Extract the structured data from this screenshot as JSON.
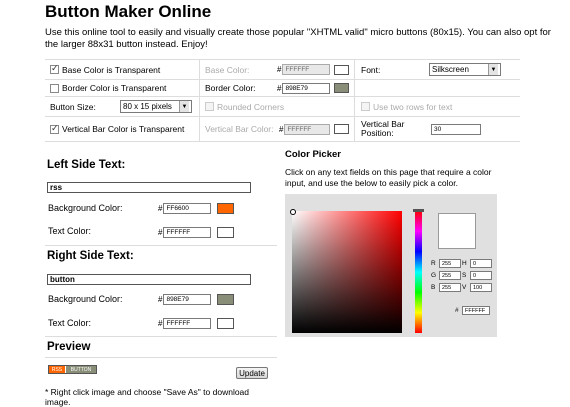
{
  "title": "Button Maker Online",
  "intro": "Use this online tool to easily and visually create those popular \"XHTML valid\" micro buttons (80x15). You can also opt for the larger 88x31 button instead. Enjoy!",
  "options": {
    "base_transparent": "Base Color is Transparent",
    "base_color_label": "Base Color:",
    "base_color_value": "FFFFFF",
    "font_label": "Font:",
    "font_value": "Silkscreen",
    "border_transparent": "Border Color is Transparent",
    "border_color_label": "Border Color:",
    "border_color_value": "898E79",
    "button_size_label": "Button Size:",
    "button_size_value": "80 x 15 pixels",
    "rounded_corners": "Rounded Corners",
    "two_rows": "Use two rows for text",
    "vertical_bar_transparent": "Vertical Bar Color is Transparent",
    "vertical_bar_color_label": "Vertical Bar Color:",
    "vertical_bar_color_value": "FFFFFF",
    "vertical_bar_position_label": "Vertical Bar Position:",
    "vertical_bar_position_value": "30"
  },
  "left": {
    "heading": "Left Side Text:",
    "text": "rss",
    "bg_label": "Background Color:",
    "bg_value": "FF6600",
    "text_color_label": "Text Color:",
    "text_color_value": "FFFFFF"
  },
  "right": {
    "heading": "Right Side Text:",
    "text": "button",
    "bg_label": "Background Color:",
    "bg_value": "898E79",
    "text_color_label": "Text Color:",
    "text_color_value": "FFFFFF"
  },
  "preview": {
    "heading": "Preview",
    "left_text": "RSS",
    "right_text": "BUTTON",
    "update_label": "Update",
    "note": "* Right click image and choose \"Save As\" to download image."
  },
  "color_picker": {
    "heading": "Color Picker",
    "desc": "Click on any text fields on this page that require a color input, and use the below to easily pick a color.",
    "r_label": "R",
    "r_value": "255",
    "g_label": "G",
    "g_value": "255",
    "b_label": "B",
    "b_value": "255",
    "h_label": "H",
    "h_value": "0",
    "s_label": "S",
    "s_value": "0",
    "v_label": "V",
    "v_value": "100",
    "hex_value": "FFFFFF"
  },
  "hash": "#",
  "colors": {
    "left_bg": "#ff6600",
    "right_bg": "#898e79",
    "border": "#898e79"
  },
  "icons": [
    "checkbox-icon",
    "dropdown-arrow-icon"
  ]
}
